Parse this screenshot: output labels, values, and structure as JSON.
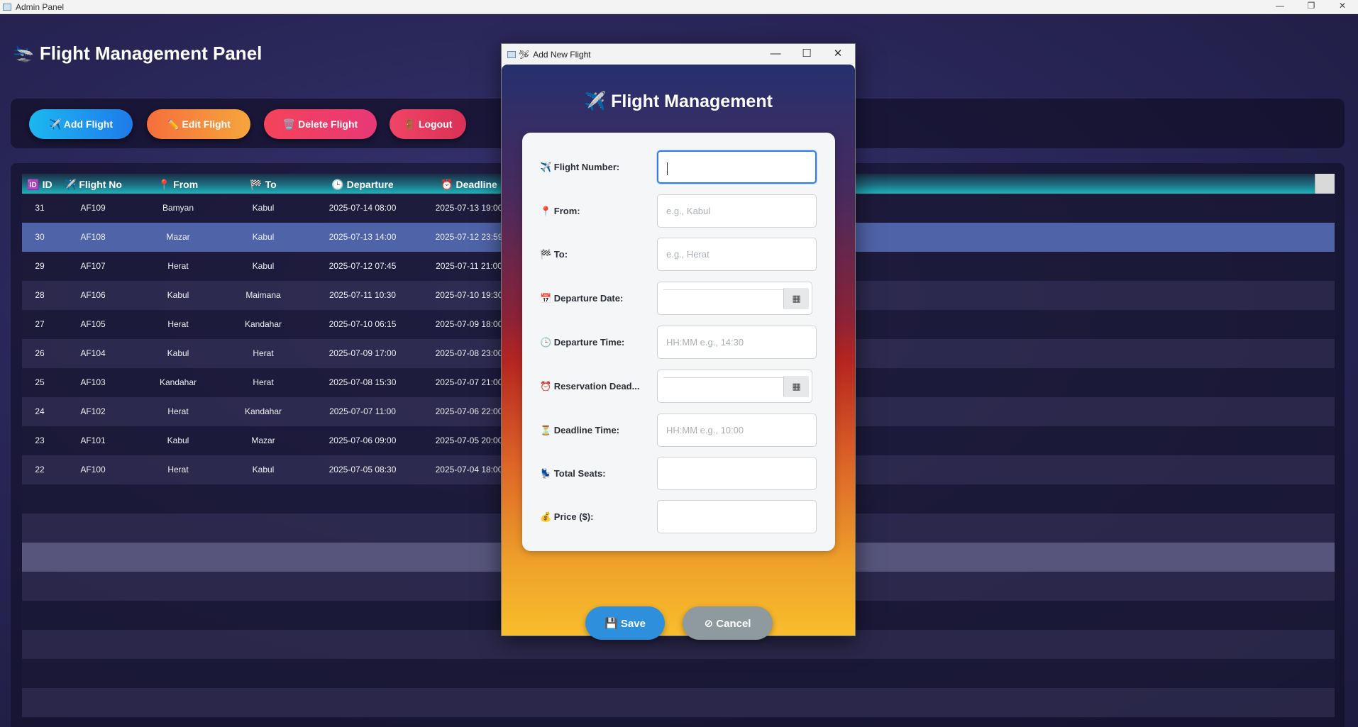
{
  "os": {
    "title": "Admin Panel",
    "minimize": "—",
    "restore": "❐",
    "close": "✕"
  },
  "panel": {
    "title_glyph": "🛬",
    "title": "Flight Management Panel"
  },
  "toolbar": {
    "add": "✈️ Add Flight",
    "edit": "✏️ Edit Flight",
    "delete": "🗑️ Delete Flight",
    "logout": "🚪 Logout"
  },
  "table": {
    "headers": [
      "🆔 ID",
      "✈️ Flight No",
      "📍 From",
      "🏁 To",
      "🕒 Departure",
      "⏰ Deadline"
    ],
    "rows": [
      [
        "31",
        "AF109",
        "Bamyan",
        "Kabul",
        "2025-07-14 08:00",
        "2025-07-13 19:00"
      ],
      [
        "30",
        "AF108",
        "Mazar",
        "Kabul",
        "2025-07-13 14:00",
        "2025-07-12 23:59"
      ],
      [
        "29",
        "AF107",
        "Herat",
        "Kabul",
        "2025-07-12 07:45",
        "2025-07-11 21:00"
      ],
      [
        "28",
        "AF106",
        "Kabul",
        "Maimana",
        "2025-07-11 10:30",
        "2025-07-10 19:30"
      ],
      [
        "27",
        "AF105",
        "Herat",
        "Kandahar",
        "2025-07-10 06:15",
        "2025-07-09 18:00"
      ],
      [
        "26",
        "AF104",
        "Kabul",
        "Herat",
        "2025-07-09 17:00",
        "2025-07-08 23:00"
      ],
      [
        "25",
        "AF103",
        "Kandahar",
        "Herat",
        "2025-07-08 15:30",
        "2025-07-07 21:00"
      ],
      [
        "24",
        "AF102",
        "Herat",
        "Kandahar",
        "2025-07-07 11:00",
        "2025-07-06 22:00"
      ],
      [
        "23",
        "AF101",
        "Kabul",
        "Mazar",
        "2025-07-06 09:00",
        "2025-07-05 20:00"
      ],
      [
        "22",
        "AF100",
        "Herat",
        "Kabul",
        "2025-07-05 08:30",
        "2025-07-04 18:00"
      ]
    ],
    "selected_row_index": 1
  },
  "dialog": {
    "title": "Add New Flight",
    "title_icon": "🛩",
    "minimize": "—",
    "maximize": "☐",
    "close": "✕",
    "heading": "✈️ Flight Management",
    "fields": {
      "flight_number": {
        "label": "✈️ Flight Number:",
        "value": "",
        "placeholder": ""
      },
      "from": {
        "label": "📍 From:",
        "placeholder": "e.g., Kabul"
      },
      "to": {
        "label": "🏁 To:",
        "placeholder": "e.g., Herat"
      },
      "departure_date": {
        "label": "📅 Departure Date:",
        "calendar_icon": "▦"
      },
      "departure_time": {
        "label": "🕒 Departure Time:",
        "placeholder": "HH:MM e.g., 14:30"
      },
      "reservation_deadline": {
        "label": "⏰ Reservation Dead...",
        "calendar_icon": "▦"
      },
      "deadline_time": {
        "label": "⏳ Deadline Time:",
        "placeholder": "HH:MM e.g., 10:00"
      },
      "total_seats": {
        "label": "💺 Total Seats:",
        "value": ""
      },
      "price": {
        "label": "💰 Price ($):",
        "value": ""
      }
    },
    "save": "💾 Save",
    "cancel": "⊘ Cancel"
  },
  "colors": {
    "accent_blue": "#2f7ff0",
    "save": "#2e8fdc",
    "cancel": "#8f9a9f",
    "selected_row": "#4f63a8"
  }
}
